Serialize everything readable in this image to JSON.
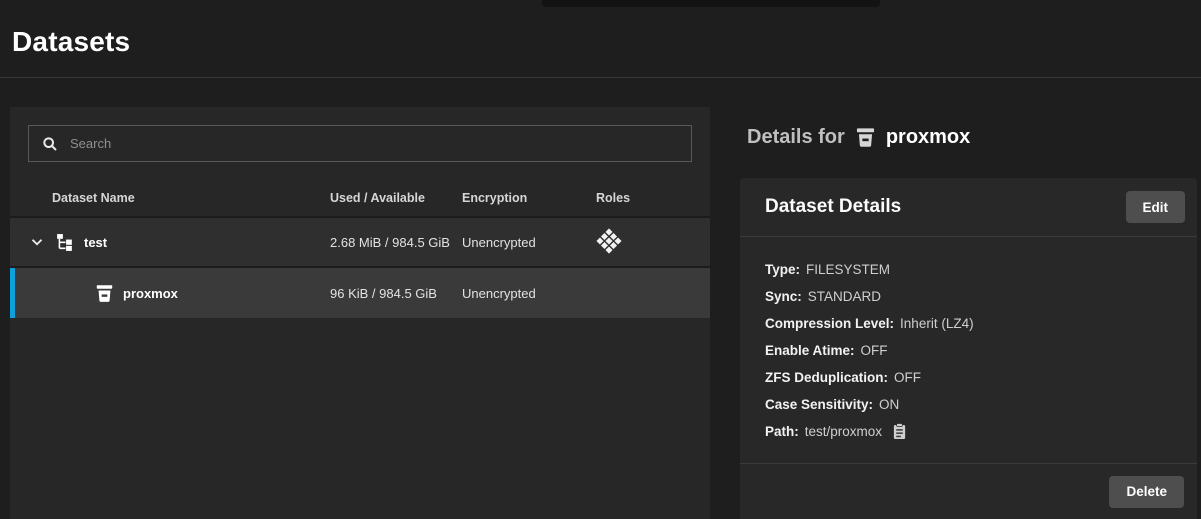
{
  "page": {
    "title": "Datasets"
  },
  "colors": {
    "accent_blue": "#0fa0da",
    "panel_bg": "#272727",
    "card_bg": "#282828",
    "selected_row_bg": "#3a3a3a",
    "button_bg": "#4e4e4e"
  },
  "icons": {
    "search": "magnifier-icon",
    "expand": "chevron-down-icon",
    "root_dataset": "dataset-tree-icon",
    "dataset": "dataset-bucket-icon",
    "roles": "apps-diamond-icon",
    "copy": "clipboard-copy-icon"
  },
  "search": {
    "placeholder": "Search"
  },
  "table": {
    "columns": {
      "name": "Dataset Name",
      "used": "Used / Available",
      "encryption": "Encryption",
      "roles": "Roles"
    },
    "rows": [
      {
        "name": "test",
        "used": "2.68 MiB / 984.5 GiB",
        "encryption": "Unencrypted",
        "has_roles_icon": true,
        "expanded": true,
        "selected": false
      },
      {
        "name": "proxmox",
        "used": "96 KiB / 984.5 GiB",
        "encryption": "Unencrypted",
        "has_roles_icon": false,
        "selected": true
      }
    ]
  },
  "details": {
    "heading_prefix": "Details for",
    "dataset_name": "proxmox",
    "card_title": "Dataset Details",
    "edit_button": "Edit",
    "delete_button": "Delete",
    "fields": [
      {
        "label": "Type:",
        "value": "FILESYSTEM"
      },
      {
        "label": "Sync:",
        "value": "STANDARD"
      },
      {
        "label": "Compression Level:",
        "value": "Inherit (LZ4)"
      },
      {
        "label": "Enable Atime:",
        "value": "OFF"
      },
      {
        "label": "ZFS Deduplication:",
        "value": "OFF"
      },
      {
        "label": "Case Sensitivity:",
        "value": "ON"
      },
      {
        "label": "Path:",
        "value": "test/proxmox",
        "copyable": true
      }
    ]
  }
}
